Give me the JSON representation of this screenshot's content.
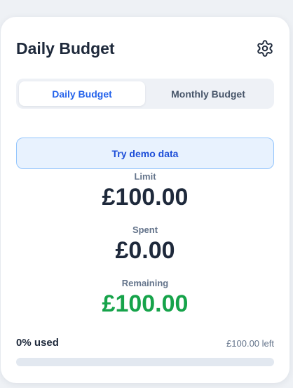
{
  "header": {
    "title": "Daily Budget",
    "settings_icon": "gear-icon"
  },
  "tabs": [
    {
      "label": "Daily Budget",
      "active": true
    },
    {
      "label": "Monthly Budget",
      "active": false
    }
  ],
  "demo_button": {
    "label": "Try demo data"
  },
  "stats": {
    "limit": {
      "label": "Limit",
      "value": "£100.00"
    },
    "spent": {
      "label": "Spent",
      "value": "£0.00"
    },
    "remaining": {
      "label": "Remaining",
      "value": "£100.00"
    }
  },
  "usage": {
    "percent_label": "0% used",
    "left_label": "£100.00 left",
    "fraction_used": 0
  },
  "colors": {
    "accent": "#2563eb",
    "positive": "#16a34a",
    "text": "#1e293b",
    "muted": "#64748b"
  }
}
